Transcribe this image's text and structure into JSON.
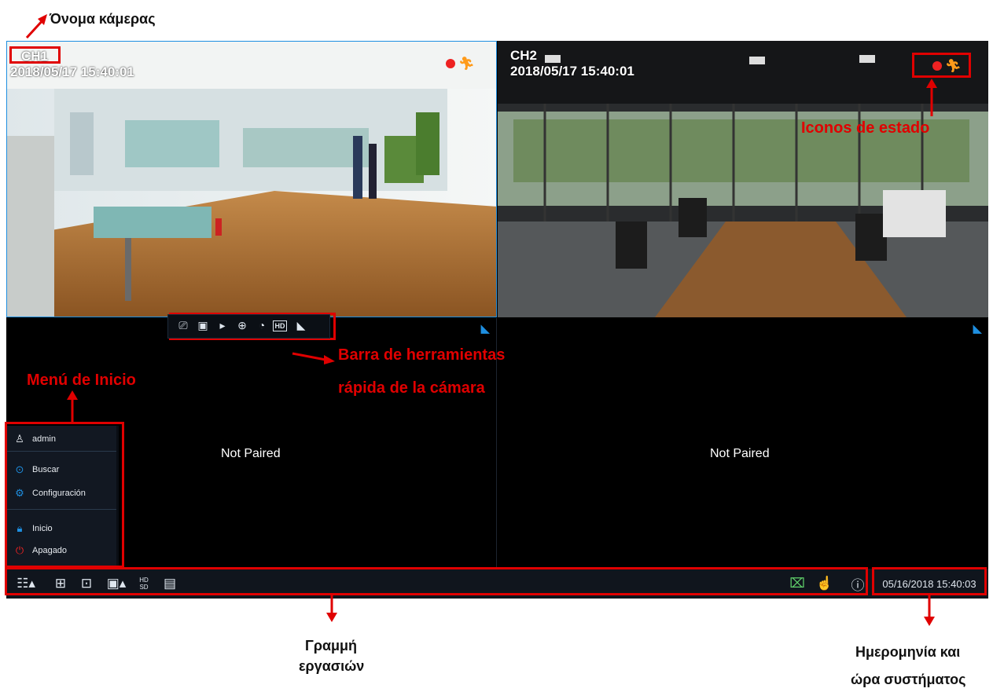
{
  "annotations": {
    "camera_name": "Όνομα κάμερας",
    "status_icons": "Iconos de estado",
    "quick_toolbar_line1": "Barra de herramientas",
    "quick_toolbar_line2": "rápida de la cámara",
    "start_menu": "Menú de Inicio",
    "taskbar_line1": "Γραμμή",
    "taskbar_line2": "εργασιών",
    "datetime_line1": "Ημερομηνία και",
    "datetime_line2": "ώρα συστήματος"
  },
  "channels": [
    {
      "name": "CH1",
      "timestamp": "2018/05/17  15:40:01"
    },
    {
      "name": "CH2",
      "timestamp": "2018/05/17  15:40:01"
    },
    {
      "status": "Not Paired"
    },
    {
      "status": "Not Paired"
    }
  ],
  "start_menu": {
    "user": "admin",
    "items": [
      "Buscar",
      "Configuración",
      "Inicio",
      "Apagado"
    ]
  },
  "taskbar": {
    "datetime": "05/16/2018 15:40:03",
    "hd_sd_label_top": "HD",
    "hd_sd_label_bottom": "SD"
  },
  "quick_toolbar": {
    "hd_label": "HD"
  },
  "colors": {
    "annotation_red": "#e00000",
    "accent_blue": "#1e8fe1",
    "status_red": "#e22222",
    "motion_orange": "#ff9b1a"
  }
}
